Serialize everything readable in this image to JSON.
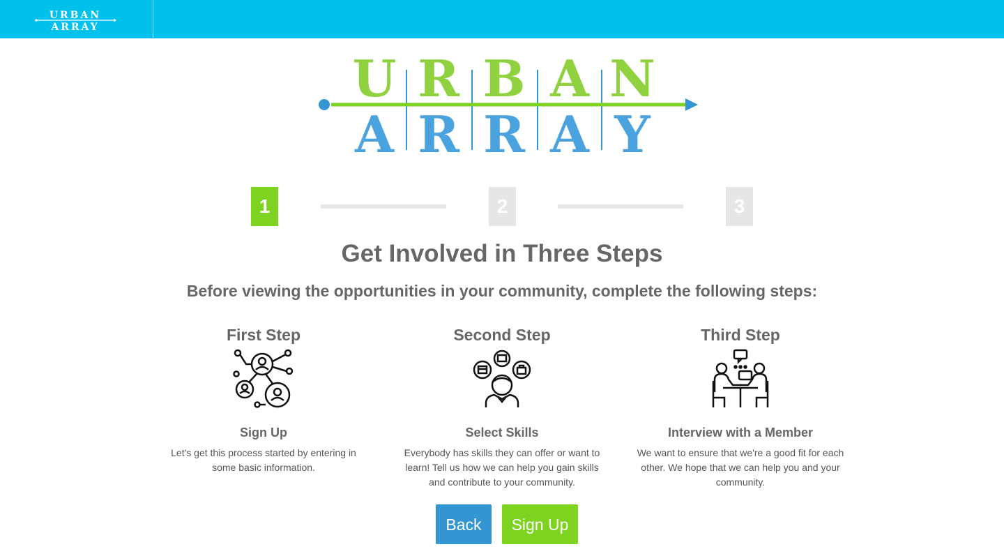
{
  "header": {
    "logo_line1": "URBAN",
    "logo_line2": "ARRAY"
  },
  "hero_logo": {
    "line1": "URBAN",
    "line2": "ARRAY"
  },
  "stepper": [
    {
      "label": "1",
      "state": "active"
    },
    {
      "label": "2",
      "state": "inactive"
    },
    {
      "label": "3",
      "state": "inactive"
    }
  ],
  "main": {
    "title": "Get Involved in Three Steps",
    "subtitle": "Before viewing the opportunities in your community, complete the following steps:"
  },
  "columns": [
    {
      "title": "First Step",
      "icon": "network-users-icon",
      "subtitle": "Sign Up",
      "description": "Let's get this process started by entering in some basic information."
    },
    {
      "title": "Second Step",
      "icon": "user-skills-icon",
      "subtitle": "Select Skills",
      "description": "Everybody has skills they can offer or want to learn! Tell us how we can help you gain skills and contribute to your community."
    },
    {
      "title": "Third Step",
      "icon": "interview-icon",
      "subtitle": "Interview with a Member",
      "description": "We want to ensure that we're a good fit for each other. We hope that we can help you and your community."
    }
  ],
  "buttons": {
    "back": "Back",
    "signup": "Sign Up"
  },
  "colors": {
    "topbar": "#00c0ec",
    "green": "#7ed321",
    "blue": "#3396d3",
    "inactive_step": "#e6e6e6",
    "text": "#666666"
  }
}
